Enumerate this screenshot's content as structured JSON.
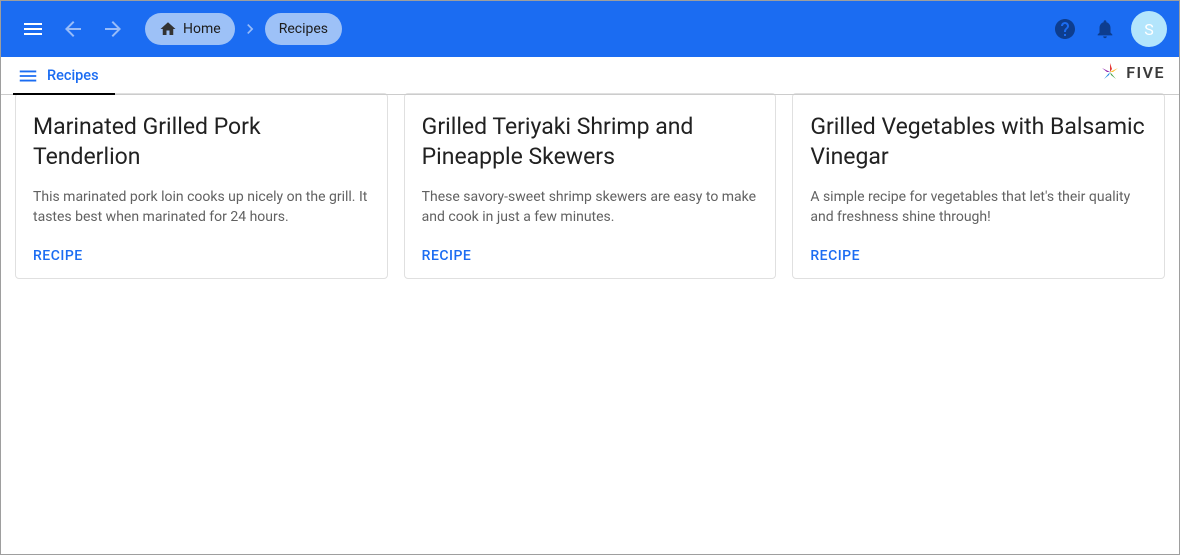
{
  "breadcrumb": {
    "home_label": "Home",
    "current_label": "Recipes"
  },
  "avatar_initial": "S",
  "tab": {
    "label": "Recipes"
  },
  "brand": "FIVE",
  "cards": [
    {
      "title": "Marinated Grilled Pork Tenderlion",
      "desc": "This marinated pork loin cooks up nicely on the grill. It tastes best when marinated for 24 hours.",
      "action": "RECIPE"
    },
    {
      "title": "Grilled Teriyaki Shrimp and Pineapple Skewers",
      "desc": "These savory-sweet shrimp skewers are easy to make and cook in just a few minutes.",
      "action": "RECIPE"
    },
    {
      "title": "Grilled Vegetables with Balsamic Vinegar",
      "desc": "A simple recipe for vegetables that let's their quality and freshness shine through!",
      "action": "RECIPE"
    }
  ]
}
